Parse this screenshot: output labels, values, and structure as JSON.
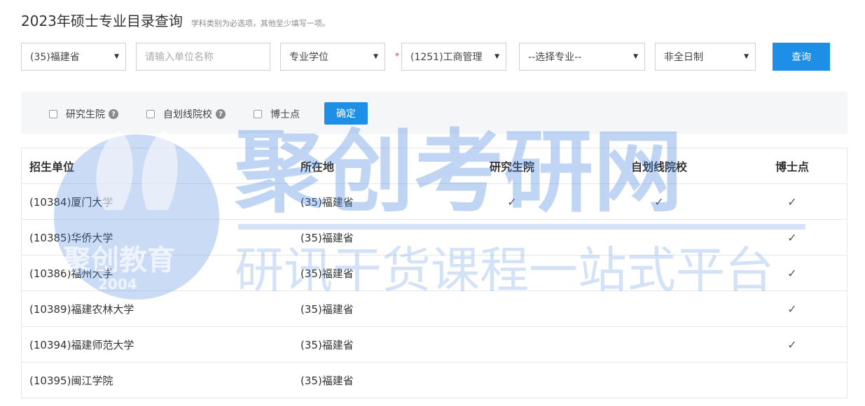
{
  "header": {
    "title": "2023年硕士专业目录查询",
    "hint": "学科类别为必选项，其他至少填写一项。"
  },
  "filters": {
    "province": "(35)福建省",
    "unit_placeholder": "请输入单位名称",
    "degree_type": "专业学位",
    "discipline": "(1251)工商管理",
    "major": "--选择专业--",
    "study_mode": "非全日制",
    "required_mark": "*",
    "query_button": "查询"
  },
  "options": {
    "grad_school": "研究生院",
    "self_line": "自划线院校",
    "phd": "博士点",
    "confirm_button": "确定"
  },
  "table": {
    "headers": [
      "招生单位",
      "所在地",
      "研究生院",
      "自划线院校",
      "博士点"
    ],
    "rows": [
      {
        "unit": "(10384)厦门大学",
        "location": "(35)福建省",
        "grad": "✓",
        "self": "✓",
        "phd": "✓"
      },
      {
        "unit": "(10385)华侨大学",
        "location": "(35)福建省",
        "grad": "",
        "self": "",
        "phd": "✓"
      },
      {
        "unit": "(10386)福州大学",
        "location": "(35)福建省",
        "grad": "",
        "self": "",
        "phd": "✓"
      },
      {
        "unit": "(10389)福建农林大学",
        "location": "(35)福建省",
        "grad": "",
        "self": "",
        "phd": "✓"
      },
      {
        "unit": "(10394)福建师范大学",
        "location": "(35)福建省",
        "grad": "",
        "self": "",
        "phd": "✓"
      },
      {
        "unit": "(10395)闽江学院",
        "location": "(35)福建省",
        "grad": "",
        "self": "",
        "phd": ""
      }
    ]
  },
  "watermark": {
    "brand": "聚创考研网",
    "slogan": "研讯干货课程一站式平台",
    "logo_text": "聚创教育",
    "logo_year": "2004",
    "color": "#3f7fe0"
  }
}
